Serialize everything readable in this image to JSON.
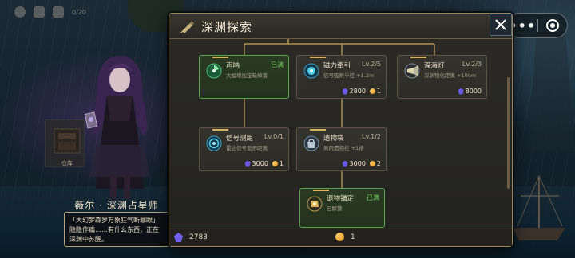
{
  "hud": {
    "counter": "0/20"
  },
  "character": {
    "name": "薇尔 · 深渊占星师",
    "quote": "「大幻梦森罗万象狂气断罪眼」隐隐作痛……有什么东西，正在深渊中苏醒。",
    "storage_label": "仓库"
  },
  "panel": {
    "title": "深渊探索"
  },
  "nodes": [
    {
      "name": "声呐",
      "level": "已满",
      "desc": "大幅增加宝箱掉落",
      "status": "maxed",
      "icon": "sonar-icon"
    },
    {
      "name": "磁力牵引",
      "level": "Lv.2/5",
      "desc": "信号吸附半径 +1.2m",
      "gems": "2800",
      "coins": "1",
      "icon": "magnet-icon"
    },
    {
      "name": "深海灯",
      "level": "Lv.2/3",
      "desc": "深渊物化距离 +100m",
      "gems": "8000",
      "icon": "lamp-icon"
    },
    {
      "name": "信号测距",
      "level": "Lv.0/1",
      "desc": "雷达信号显示距离",
      "gems": "3000",
      "coins": "1",
      "icon": "radar-icon"
    },
    {
      "name": "遗物袋",
      "level": "Lv.1/2",
      "desc": "局内遗物栏 +1格",
      "gems": "3000",
      "coins": "2",
      "icon": "bag-icon"
    },
    {
      "name": "遗物锚定",
      "level": "已满",
      "desc": "已解锁",
      "status": "maxed",
      "icon": "anchor-icon"
    }
  ],
  "resources": {
    "gems": "2783",
    "coins": "1"
  },
  "colors": {
    "accent": "#d8b25e",
    "maxed": "#6fd05a",
    "gem": "#6b5ae8",
    "coin": "#f0a82a",
    "panel_border": "#9a865c"
  }
}
